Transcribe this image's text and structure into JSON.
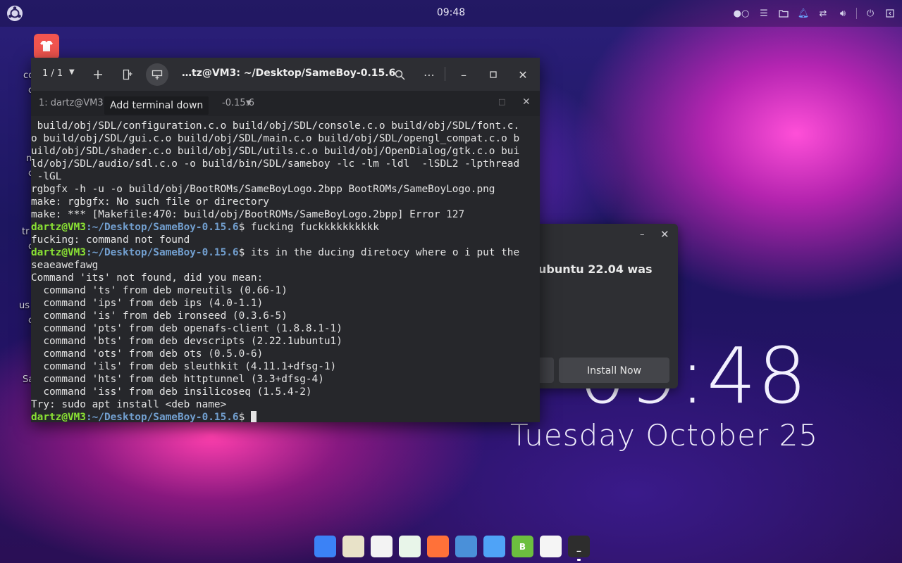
{
  "topbar": {
    "clock": "09:48",
    "tray_icons": [
      "workspace-indicator-icon",
      "tasks-icon",
      "files-icon",
      "notifications-icon",
      "network-icon",
      "volume-icon",
      "power-icon",
      "show-desktop-icon"
    ]
  },
  "desktop": {
    "labels": [
      "co",
      "c",
      "n",
      "c",
      "tr",
      "c",
      "us",
      "c",
      "Sa"
    ],
    "clock_time": "09:48",
    "clock_date": "Tuesday October 25"
  },
  "update_dialog": {
    "text": "ubuntu 22.04 was",
    "install_label": "Install Now"
  },
  "terminal": {
    "session_count": "1 / 1",
    "title": "…tz@VM3: ~/Desktop/SameBoy-0.15.6",
    "tab_left": "1: dartz@VM3",
    "tab_right": "-0.15.6",
    "tooltip": "Add terminal down",
    "prompt_user": "dartz@VM3",
    "prompt_path": ":~/Desktop/SameBoy-0.15.6",
    "lines": [
      {
        "type": "out",
        "text": " build/obj/SDL/configuration.c.o build/obj/SDL/console.c.o build/obj/SDL/font.c."
      },
      {
        "type": "out",
        "text": "o build/obj/SDL/gui.c.o build/obj/SDL/main.c.o build/obj/SDL/opengl_compat.c.o b"
      },
      {
        "type": "out",
        "text": "uild/obj/SDL/shader.c.o build/obj/SDL/utils.c.o build/obj/OpenDialog/gtk.c.o bui"
      },
      {
        "type": "out",
        "text": "ld/obj/SDL/audio/sdl.c.o -o build/bin/SDL/sameboy -lc -lm -ldl  -lSDL2 -lpthread"
      },
      {
        "type": "out",
        "text": " -lGL"
      },
      {
        "type": "out",
        "text": "rgbgfx -h -u -o build/obj/BootROMs/SameBoyLogo.2bpp BootROMs/SameBoyLogo.png"
      },
      {
        "type": "out",
        "text": "make: rgbgfx: No such file or directory"
      },
      {
        "type": "out",
        "text": "make: *** [Makefile:470: build/obj/BootROMs/SameBoyLogo.2bpp] Error 127"
      },
      {
        "type": "cmd",
        "text": "$ fucking fuckkkkkkkkkk"
      },
      {
        "type": "out",
        "text": "fucking: command not found"
      },
      {
        "type": "cmd",
        "text": "$ its in the ducing diretocy where o i put the"
      },
      {
        "type": "out",
        "text": "seaeawefawg"
      },
      {
        "type": "out",
        "text": "Command 'its' not found, did you mean:"
      },
      {
        "type": "out",
        "text": "  command 'ts' from deb moreutils (0.66-1)"
      },
      {
        "type": "out",
        "text": "  command 'ips' from deb ips (4.0-1.1)"
      },
      {
        "type": "out",
        "text": "  command 'is' from deb ironseed (0.3.6-5)"
      },
      {
        "type": "out",
        "text": "  command 'pts' from deb openafs-client (1.8.8.1-1)"
      },
      {
        "type": "out",
        "text": "  command 'bts' from deb devscripts (2.22.1ubuntu1)"
      },
      {
        "type": "out",
        "text": "  command 'ots' from deb ots (0.5.0-6)"
      },
      {
        "type": "out",
        "text": "  command 'ils' from deb sleuthkit (4.11.1+dfsg-1)"
      },
      {
        "type": "out",
        "text": "  command 'hts' from deb httptunnel (3.3+dfsg-4)"
      },
      {
        "type": "out",
        "text": "  command 'iss' from deb insilicoseq (1.5.4-2)"
      },
      {
        "type": "out",
        "text": "Try: sudo apt install <deb name>"
      },
      {
        "type": "cmd",
        "text": "$ "
      }
    ]
  },
  "dock": [
    {
      "name": "app-store-icon",
      "color": "#3b82f6",
      "glyph": ""
    },
    {
      "name": "rhythmbox-icon",
      "color": "#e8e2c8",
      "glyph": ""
    },
    {
      "name": "text-editor-icon",
      "color": "#f3f3f3",
      "glyph": ""
    },
    {
      "name": "spreadsheet-icon",
      "color": "#e8f5e9",
      "glyph": ""
    },
    {
      "name": "firefox-icon",
      "color": "#ff7139",
      "glyph": ""
    },
    {
      "name": "files-icon",
      "color": "#4a90d9",
      "glyph": ""
    },
    {
      "name": "software-updater-icon",
      "color": "#4fa3f7",
      "glyph": ""
    },
    {
      "name": "package-installer-icon",
      "color": "#6cbf3f",
      "glyph": "B"
    },
    {
      "name": "document-viewer-icon",
      "color": "#f5f5f5",
      "glyph": ""
    },
    {
      "name": "terminal-icon",
      "color": "#2d2d2d",
      "glyph": "_"
    }
  ]
}
